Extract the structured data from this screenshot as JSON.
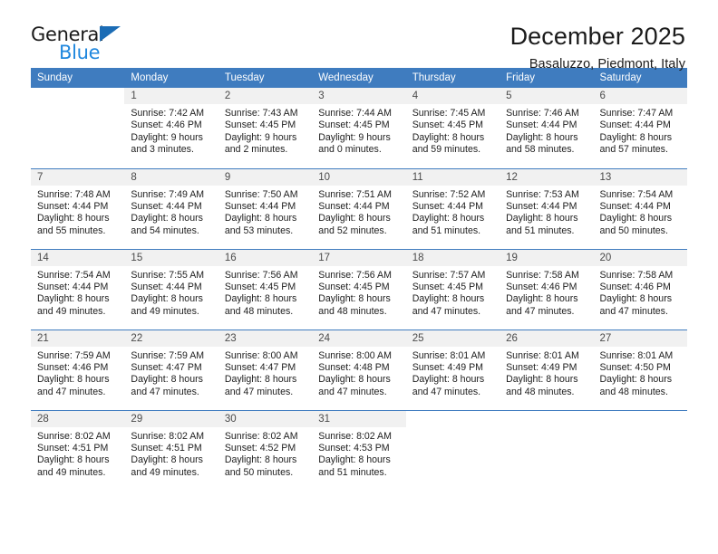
{
  "brand": {
    "name_top": "General",
    "name_bottom": "Blue",
    "accent_color": "#1f87de",
    "triangle_color": "#1b6cb5"
  },
  "header": {
    "title": "December 2025",
    "subtitle": "Basaluzzo, Piedmont, Italy"
  },
  "theme": {
    "header_bg": "#3f7cbf",
    "header_text": "#ffffff",
    "daynum_bg": "#f1f1f1",
    "row_border": "#3f7cbf"
  },
  "weekdays": [
    "Sunday",
    "Monday",
    "Tuesday",
    "Wednesday",
    "Thursday",
    "Friday",
    "Saturday"
  ],
  "weeks": [
    [
      {
        "day": "",
        "sunrise": "",
        "sunset": "",
        "daylight_line1": "",
        "daylight_line2": ""
      },
      {
        "day": "1",
        "sunrise": "Sunrise: 7:42 AM",
        "sunset": "Sunset: 4:46 PM",
        "daylight_line1": "Daylight: 9 hours",
        "daylight_line2": "and 3 minutes."
      },
      {
        "day": "2",
        "sunrise": "Sunrise: 7:43 AM",
        "sunset": "Sunset: 4:45 PM",
        "daylight_line1": "Daylight: 9 hours",
        "daylight_line2": "and 2 minutes."
      },
      {
        "day": "3",
        "sunrise": "Sunrise: 7:44 AM",
        "sunset": "Sunset: 4:45 PM",
        "daylight_line1": "Daylight: 9 hours",
        "daylight_line2": "and 0 minutes."
      },
      {
        "day": "4",
        "sunrise": "Sunrise: 7:45 AM",
        "sunset": "Sunset: 4:45 PM",
        "daylight_line1": "Daylight: 8 hours",
        "daylight_line2": "and 59 minutes."
      },
      {
        "day": "5",
        "sunrise": "Sunrise: 7:46 AM",
        "sunset": "Sunset: 4:44 PM",
        "daylight_line1": "Daylight: 8 hours",
        "daylight_line2": "and 58 minutes."
      },
      {
        "day": "6",
        "sunrise": "Sunrise: 7:47 AM",
        "sunset": "Sunset: 4:44 PM",
        "daylight_line1": "Daylight: 8 hours",
        "daylight_line2": "and 57 minutes."
      }
    ],
    [
      {
        "day": "7",
        "sunrise": "Sunrise: 7:48 AM",
        "sunset": "Sunset: 4:44 PM",
        "daylight_line1": "Daylight: 8 hours",
        "daylight_line2": "and 55 minutes."
      },
      {
        "day": "8",
        "sunrise": "Sunrise: 7:49 AM",
        "sunset": "Sunset: 4:44 PM",
        "daylight_line1": "Daylight: 8 hours",
        "daylight_line2": "and 54 minutes."
      },
      {
        "day": "9",
        "sunrise": "Sunrise: 7:50 AM",
        "sunset": "Sunset: 4:44 PM",
        "daylight_line1": "Daylight: 8 hours",
        "daylight_line2": "and 53 minutes."
      },
      {
        "day": "10",
        "sunrise": "Sunrise: 7:51 AM",
        "sunset": "Sunset: 4:44 PM",
        "daylight_line1": "Daylight: 8 hours",
        "daylight_line2": "and 52 minutes."
      },
      {
        "day": "11",
        "sunrise": "Sunrise: 7:52 AM",
        "sunset": "Sunset: 4:44 PM",
        "daylight_line1": "Daylight: 8 hours",
        "daylight_line2": "and 51 minutes."
      },
      {
        "day": "12",
        "sunrise": "Sunrise: 7:53 AM",
        "sunset": "Sunset: 4:44 PM",
        "daylight_line1": "Daylight: 8 hours",
        "daylight_line2": "and 51 minutes."
      },
      {
        "day": "13",
        "sunrise": "Sunrise: 7:54 AM",
        "sunset": "Sunset: 4:44 PM",
        "daylight_line1": "Daylight: 8 hours",
        "daylight_line2": "and 50 minutes."
      }
    ],
    [
      {
        "day": "14",
        "sunrise": "Sunrise: 7:54 AM",
        "sunset": "Sunset: 4:44 PM",
        "daylight_line1": "Daylight: 8 hours",
        "daylight_line2": "and 49 minutes."
      },
      {
        "day": "15",
        "sunrise": "Sunrise: 7:55 AM",
        "sunset": "Sunset: 4:44 PM",
        "daylight_line1": "Daylight: 8 hours",
        "daylight_line2": "and 49 minutes."
      },
      {
        "day": "16",
        "sunrise": "Sunrise: 7:56 AM",
        "sunset": "Sunset: 4:45 PM",
        "daylight_line1": "Daylight: 8 hours",
        "daylight_line2": "and 48 minutes."
      },
      {
        "day": "17",
        "sunrise": "Sunrise: 7:56 AM",
        "sunset": "Sunset: 4:45 PM",
        "daylight_line1": "Daylight: 8 hours",
        "daylight_line2": "and 48 minutes."
      },
      {
        "day": "18",
        "sunrise": "Sunrise: 7:57 AM",
        "sunset": "Sunset: 4:45 PM",
        "daylight_line1": "Daylight: 8 hours",
        "daylight_line2": "and 47 minutes."
      },
      {
        "day": "19",
        "sunrise": "Sunrise: 7:58 AM",
        "sunset": "Sunset: 4:46 PM",
        "daylight_line1": "Daylight: 8 hours",
        "daylight_line2": "and 47 minutes."
      },
      {
        "day": "20",
        "sunrise": "Sunrise: 7:58 AM",
        "sunset": "Sunset: 4:46 PM",
        "daylight_line1": "Daylight: 8 hours",
        "daylight_line2": "and 47 minutes."
      }
    ],
    [
      {
        "day": "21",
        "sunrise": "Sunrise: 7:59 AM",
        "sunset": "Sunset: 4:46 PM",
        "daylight_line1": "Daylight: 8 hours",
        "daylight_line2": "and 47 minutes."
      },
      {
        "day": "22",
        "sunrise": "Sunrise: 7:59 AM",
        "sunset": "Sunset: 4:47 PM",
        "daylight_line1": "Daylight: 8 hours",
        "daylight_line2": "and 47 minutes."
      },
      {
        "day": "23",
        "sunrise": "Sunrise: 8:00 AM",
        "sunset": "Sunset: 4:47 PM",
        "daylight_line1": "Daylight: 8 hours",
        "daylight_line2": "and 47 minutes."
      },
      {
        "day": "24",
        "sunrise": "Sunrise: 8:00 AM",
        "sunset": "Sunset: 4:48 PM",
        "daylight_line1": "Daylight: 8 hours",
        "daylight_line2": "and 47 minutes."
      },
      {
        "day": "25",
        "sunrise": "Sunrise: 8:01 AM",
        "sunset": "Sunset: 4:49 PM",
        "daylight_line1": "Daylight: 8 hours",
        "daylight_line2": "and 47 minutes."
      },
      {
        "day": "26",
        "sunrise": "Sunrise: 8:01 AM",
        "sunset": "Sunset: 4:49 PM",
        "daylight_line1": "Daylight: 8 hours",
        "daylight_line2": "and 48 minutes."
      },
      {
        "day": "27",
        "sunrise": "Sunrise: 8:01 AM",
        "sunset": "Sunset: 4:50 PM",
        "daylight_line1": "Daylight: 8 hours",
        "daylight_line2": "and 48 minutes."
      }
    ],
    [
      {
        "day": "28",
        "sunrise": "Sunrise: 8:02 AM",
        "sunset": "Sunset: 4:51 PM",
        "daylight_line1": "Daylight: 8 hours",
        "daylight_line2": "and 49 minutes."
      },
      {
        "day": "29",
        "sunrise": "Sunrise: 8:02 AM",
        "sunset": "Sunset: 4:51 PM",
        "daylight_line1": "Daylight: 8 hours",
        "daylight_line2": "and 49 minutes."
      },
      {
        "day": "30",
        "sunrise": "Sunrise: 8:02 AM",
        "sunset": "Sunset: 4:52 PM",
        "daylight_line1": "Daylight: 8 hours",
        "daylight_line2": "and 50 minutes."
      },
      {
        "day": "31",
        "sunrise": "Sunrise: 8:02 AM",
        "sunset": "Sunset: 4:53 PM",
        "daylight_line1": "Daylight: 8 hours",
        "daylight_line2": "and 51 minutes."
      },
      {
        "day": "",
        "sunrise": "",
        "sunset": "",
        "daylight_line1": "",
        "daylight_line2": ""
      },
      {
        "day": "",
        "sunrise": "",
        "sunset": "",
        "daylight_line1": "",
        "daylight_line2": ""
      },
      {
        "day": "",
        "sunrise": "",
        "sunset": "",
        "daylight_line1": "",
        "daylight_line2": ""
      }
    ]
  ]
}
